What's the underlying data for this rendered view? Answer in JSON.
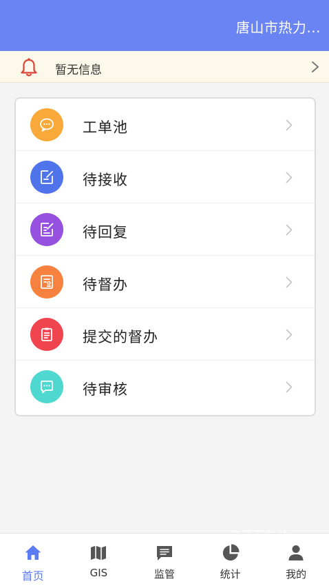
{
  "header": {
    "title": "唐山市热力..."
  },
  "notice": {
    "text": "暂无信息"
  },
  "menu": {
    "items": [
      {
        "label": "工单池",
        "icon": "chat-bubble-icon",
        "color": "#f9a93a"
      },
      {
        "label": "待接收",
        "icon": "edit-note-icon",
        "color": "#4f73ea"
      },
      {
        "label": "待回复",
        "icon": "edit-list-icon",
        "color": "#9550e0"
      },
      {
        "label": "待督办",
        "icon": "document-stamp-icon",
        "color": "#f7813f"
      },
      {
        "label": "提交的督办",
        "icon": "clipboard-icon",
        "color": "#f0444e"
      },
      {
        "label": "待审核",
        "icon": "message-dots-icon",
        "color": "#4fd8cf"
      }
    ]
  },
  "watermark": "晓夏下载站",
  "tabbar": {
    "active_color": "#5b7cf2",
    "items": [
      {
        "label": "首页",
        "icon": "home-icon"
      },
      {
        "label": "GIS",
        "icon": "map-icon"
      },
      {
        "label": "监管",
        "icon": "message-icon"
      },
      {
        "label": "统计",
        "icon": "pie-chart-icon"
      },
      {
        "label": "我的",
        "icon": "user-icon"
      }
    ]
  }
}
